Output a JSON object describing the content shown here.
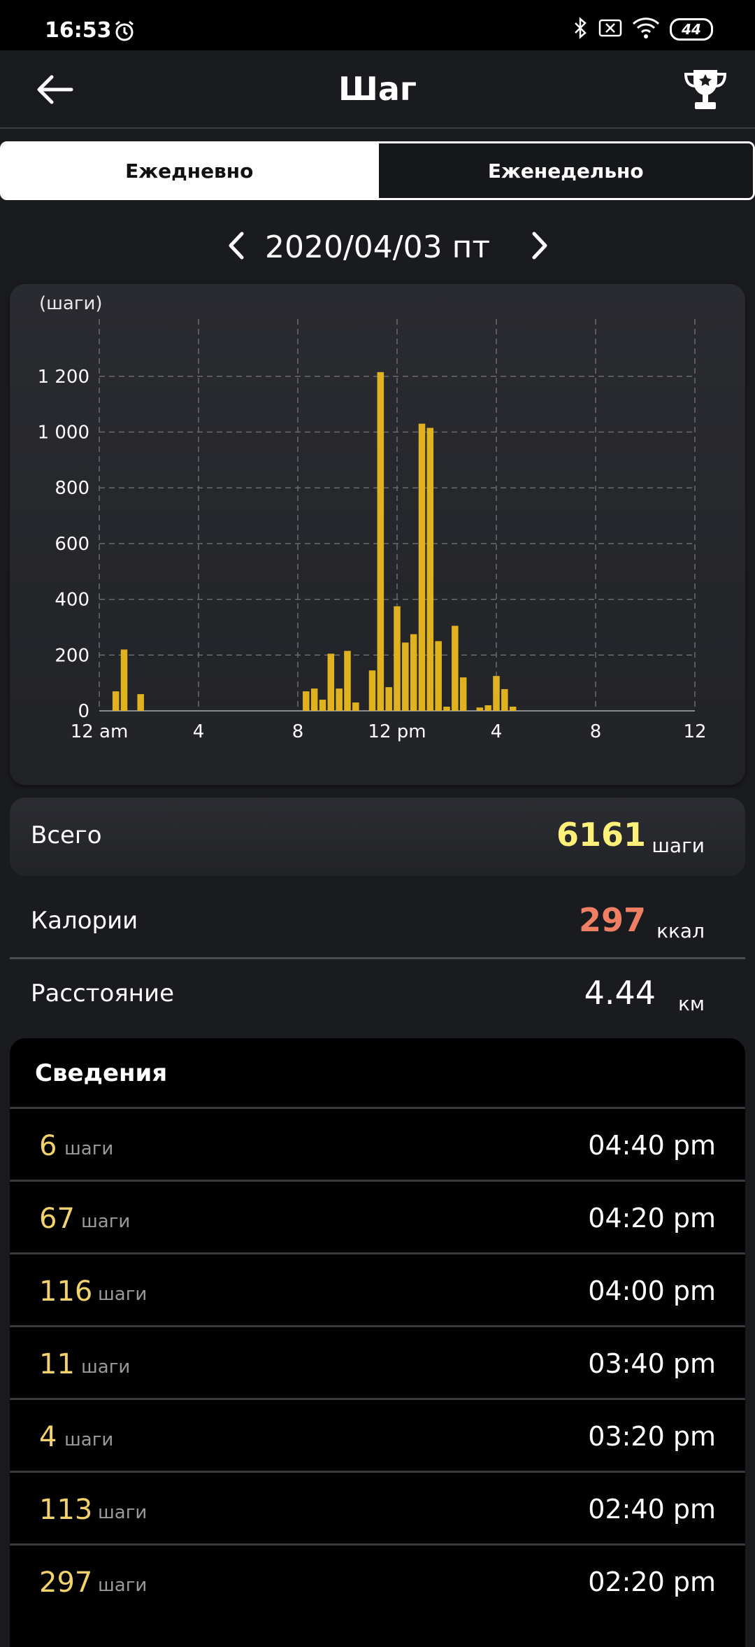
{
  "status_bar": {
    "time": "16:53",
    "battery": "44",
    "icons": [
      "alarm-icon",
      "bluetooth-icon",
      "no-sim-icon",
      "wifi-icon",
      "battery-icon"
    ]
  },
  "app_bar": {
    "title": "Шаг",
    "back_icon": "back-arrow-icon",
    "trophy_icon": "trophy-icon"
  },
  "tabs": {
    "daily": "Ежедневно",
    "weekly": "Еженедельно",
    "selected": "daily"
  },
  "date_nav": {
    "date": "2020/04/03 пт"
  },
  "chart_data": {
    "type": "bar",
    "ylabel": "(шаги)",
    "ylim": [
      0,
      1320
    ],
    "yticks": [
      0,
      200,
      400,
      600,
      800,
      1000,
      1200
    ],
    "ytick_labels": [
      "0",
      "200",
      "400",
      "600",
      "800",
      "1 000",
      "1 200"
    ],
    "xlim": [
      0,
      24
    ],
    "xticks": [
      0,
      4,
      8,
      12,
      16,
      20,
      24
    ],
    "xtick_labels": [
      "12 am",
      "4",
      "8",
      "12 pm",
      "4",
      "8",
      "12"
    ],
    "grid": true,
    "color": "#e0b21f",
    "x": [
      0.667,
      1.0,
      1.667,
      8.333,
      8.667,
      9.0,
      9.333,
      9.667,
      10.0,
      10.333,
      11.0,
      11.333,
      11.667,
      12.0,
      12.333,
      12.667,
      13.0,
      13.333,
      13.667,
      14.0,
      14.333,
      14.667,
      15.333,
      15.667,
      16.0,
      16.333,
      16.667
    ],
    "values": [
      70,
      220,
      60,
      70,
      80,
      40,
      205,
      80,
      215,
      30,
      145,
      1215,
      85,
      375,
      245,
      275,
      1030,
      1015,
      250,
      15,
      305,
      120,
      12,
      20,
      125,
      78,
      15
    ]
  },
  "total": {
    "label": "Всего",
    "value": "6161",
    "unit": "шаги",
    "value_color": "#fff07a"
  },
  "calories": {
    "label": "Калории",
    "value": "297",
    "unit": "ккал",
    "value_color": "#f08063"
  },
  "distance": {
    "label": "Расстояние",
    "value": "4.44",
    "unit": "км"
  },
  "details": {
    "title": "Сведения",
    "rows": [
      {
        "value": "6",
        "unit": "шаги",
        "time": "04:40 pm"
      },
      {
        "value": "67",
        "unit": "шаги",
        "time": "04:20 pm"
      },
      {
        "value": "116",
        "unit": "шаги",
        "time": "04:00 pm"
      },
      {
        "value": "11",
        "unit": "шаги",
        "time": "03:40 pm"
      },
      {
        "value": "4",
        "unit": "шаги",
        "time": "03:20 pm"
      },
      {
        "value": "113",
        "unit": "шаги",
        "time": "02:40 pm"
      },
      {
        "value": "297",
        "unit": "шаги",
        "time": "02:20 pm"
      }
    ]
  }
}
